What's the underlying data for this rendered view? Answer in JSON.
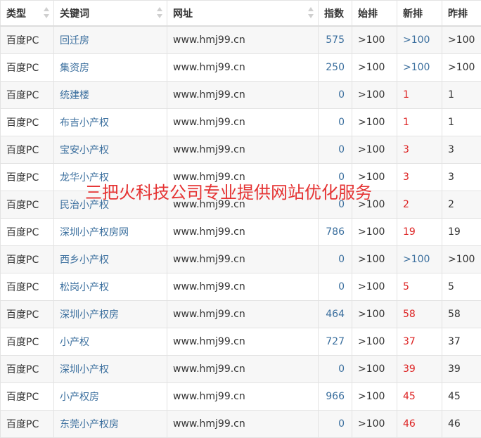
{
  "headers": {
    "type": "类型",
    "keyword": "关键词",
    "url": "网址",
    "index": "指数",
    "first_rank": "始排",
    "new_rank": "新排",
    "yesterday_rank": "昨排"
  },
  "watermark": "三把火科技公司专业提供网站优化服务",
  "colors": {
    "link": "#3b6f9e",
    "highlight_red": "#dd2222",
    "stripe": "#f7f7f7",
    "border": "#e3e3e3"
  },
  "rows": [
    {
      "type": "百度PC",
      "keyword": "回迁房",
      "url": "www.hmj99.cn",
      "index": "575",
      "first": ">100",
      "new": ">100",
      "new_color": "link",
      "yesterday": ">100"
    },
    {
      "type": "百度PC",
      "keyword": "集资房",
      "url": "www.hmj99.cn",
      "index": "250",
      "first": ">100",
      "new": ">100",
      "new_color": "link",
      "yesterday": ">100"
    },
    {
      "type": "百度PC",
      "keyword": "统建楼",
      "url": "www.hmj99.cn",
      "index": "0",
      "first": ">100",
      "new": "1",
      "new_color": "red",
      "yesterday": "1"
    },
    {
      "type": "百度PC",
      "keyword": "布吉小产权",
      "url": "www.hmj99.cn",
      "index": "0",
      "first": ">100",
      "new": "1",
      "new_color": "red",
      "yesterday": "1"
    },
    {
      "type": "百度PC",
      "keyword": "宝安小产权",
      "url": "www.hmj99.cn",
      "index": "0",
      "first": ">100",
      "new": "3",
      "new_color": "red",
      "yesterday": "3"
    },
    {
      "type": "百度PC",
      "keyword": "龙华小产权",
      "url": "www.hmj99.cn",
      "index": "0",
      "first": ">100",
      "new": "3",
      "new_color": "red",
      "yesterday": "3"
    },
    {
      "type": "百度PC",
      "keyword": "民治小产权",
      "url": "www.hmj99.cn",
      "index": "0",
      "first": ">100",
      "new": "2",
      "new_color": "red",
      "yesterday": "2"
    },
    {
      "type": "百度PC",
      "keyword": "深圳小产权房网",
      "url": "www.hmj99.cn",
      "index": "786",
      "first": ">100",
      "new": "19",
      "new_color": "red",
      "yesterday": "19"
    },
    {
      "type": "百度PC",
      "keyword": "西乡小产权",
      "url": "www.hmj99.cn",
      "index": "0",
      "first": ">100",
      "new": ">100",
      "new_color": "link",
      "yesterday": ">100"
    },
    {
      "type": "百度PC",
      "keyword": "松岗小产权",
      "url": "www.hmj99.cn",
      "index": "0",
      "first": ">100",
      "new": "5",
      "new_color": "red",
      "yesterday": "5"
    },
    {
      "type": "百度PC",
      "keyword": "深圳小产权房",
      "url": "www.hmj99.cn",
      "index": "464",
      "first": ">100",
      "new": "58",
      "new_color": "red",
      "yesterday": "58"
    },
    {
      "type": "百度PC",
      "keyword": "小产权",
      "url": "www.hmj99.cn",
      "index": "727",
      "first": ">100",
      "new": "37",
      "new_color": "red",
      "yesterday": "37"
    },
    {
      "type": "百度PC",
      "keyword": "深圳小产权",
      "url": "www.hmj99.cn",
      "index": "0",
      "first": ">100",
      "new": "39",
      "new_color": "red",
      "yesterday": "39"
    },
    {
      "type": "百度PC",
      "keyword": "小产权房",
      "url": "www.hmj99.cn",
      "index": "966",
      "first": ">100",
      "new": "45",
      "new_color": "red",
      "yesterday": "45"
    },
    {
      "type": "百度PC",
      "keyword": "东莞小产权房",
      "url": "www.hmj99.cn",
      "index": "0",
      "first": ">100",
      "new": "46",
      "new_color": "red",
      "yesterday": "46"
    }
  ]
}
